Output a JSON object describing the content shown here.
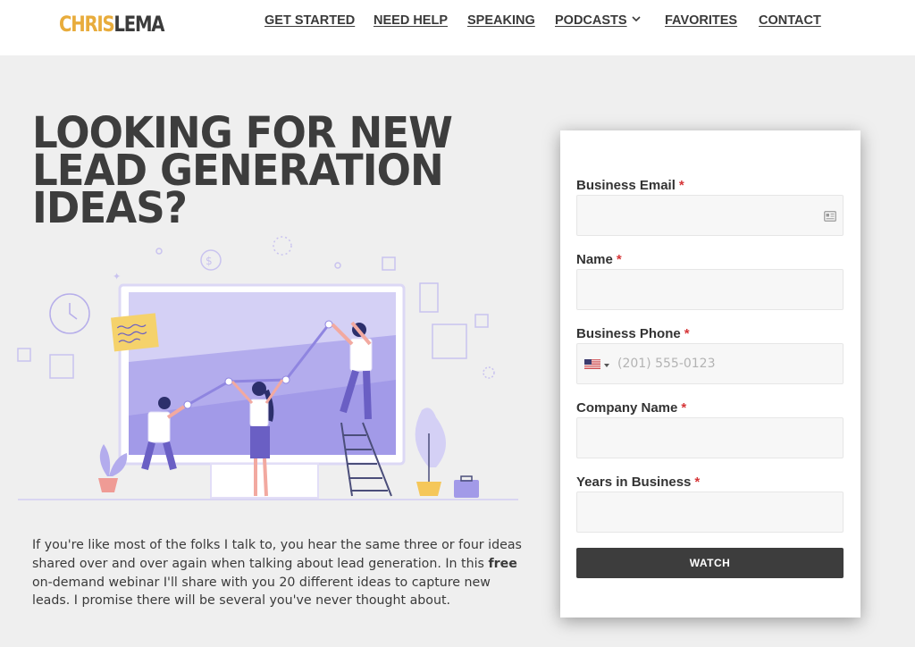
{
  "brand": {
    "logo_part1": "CHRIS",
    "logo_part2": "LEMA"
  },
  "nav": {
    "items": [
      {
        "label": "GET STARTED"
      },
      {
        "label": "NEED HELP"
      },
      {
        "label": "SPEAKING"
      },
      {
        "label": "PODCASTS"
      },
      {
        "label": "FAVORITES"
      },
      {
        "label": "CONTACT"
      }
    ]
  },
  "hero": {
    "headline_lines": [
      "LOOKING FOR NEW",
      "LEAD GENERATION",
      "IDEAS?"
    ],
    "intro_line1": "If you're like most of the folks I talk to, you hear the same three or four ideas",
    "intro_line2_pre": "shared over and over again when talking about lead generation. In this ",
    "intro_line2_bold": "free",
    "intro_line3": "on-demand webinar I'll share with you 20 different ideas to capture new",
    "intro_line4": "leads. I promise there will be several you've never thought about."
  },
  "form": {
    "fields": [
      {
        "label": "Business Email",
        "required_mark": "*",
        "value": "",
        "placeholder": ""
      },
      {
        "label": "Name",
        "required_mark": "*",
        "value": "",
        "placeholder": ""
      },
      {
        "label": "Business Phone",
        "required_mark": "*",
        "value": "",
        "placeholder": "(201) 555-0123"
      },
      {
        "label": "Company Name",
        "required_mark": "*",
        "value": "",
        "placeholder": ""
      },
      {
        "label": "Years in Business",
        "required_mark": "*",
        "value": "",
        "placeholder": ""
      }
    ],
    "submit_label": "WATCH"
  },
  "icons": {
    "nav_dropdown": "chevron-down-icon",
    "email_autofill": "contact-card-icon",
    "phone_country": "us-flag-icon"
  },
  "colors": {
    "accent_logo": "#e8ac3c",
    "text_dark": "#3a3a3a",
    "page_bg": "#efefef",
    "button_bg": "#3d3d3d",
    "required": "#d63638",
    "illustration_purple": "#8f85e0"
  }
}
